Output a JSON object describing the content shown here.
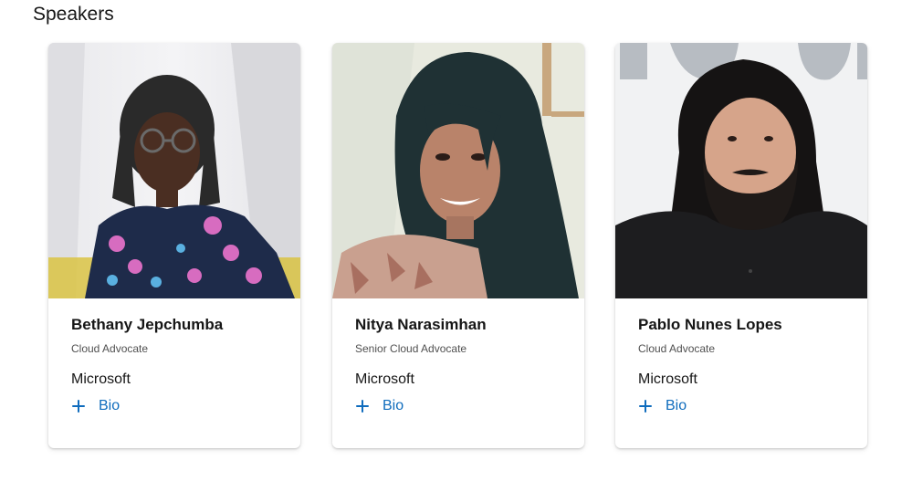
{
  "section": {
    "title": "Speakers"
  },
  "speakers": [
    {
      "name": "Bethany Jepchumba",
      "role": "Cloud Advocate",
      "company": "Microsoft",
      "bio_label": "Bio",
      "photo_icon": "speaker-photo"
    },
    {
      "name": "Nitya Narasimhan",
      "role": "Senior Cloud Advocate",
      "company": "Microsoft",
      "bio_label": "Bio",
      "photo_icon": "speaker-photo"
    },
    {
      "name": "Pablo Nunes Lopes",
      "role": "Cloud Advocate",
      "company": "Microsoft",
      "bio_label": "Bio",
      "photo_icon": "speaker-photo"
    }
  ],
  "colors": {
    "link": "#0f6cbd",
    "text": "#161616",
    "muted": "#505050"
  }
}
